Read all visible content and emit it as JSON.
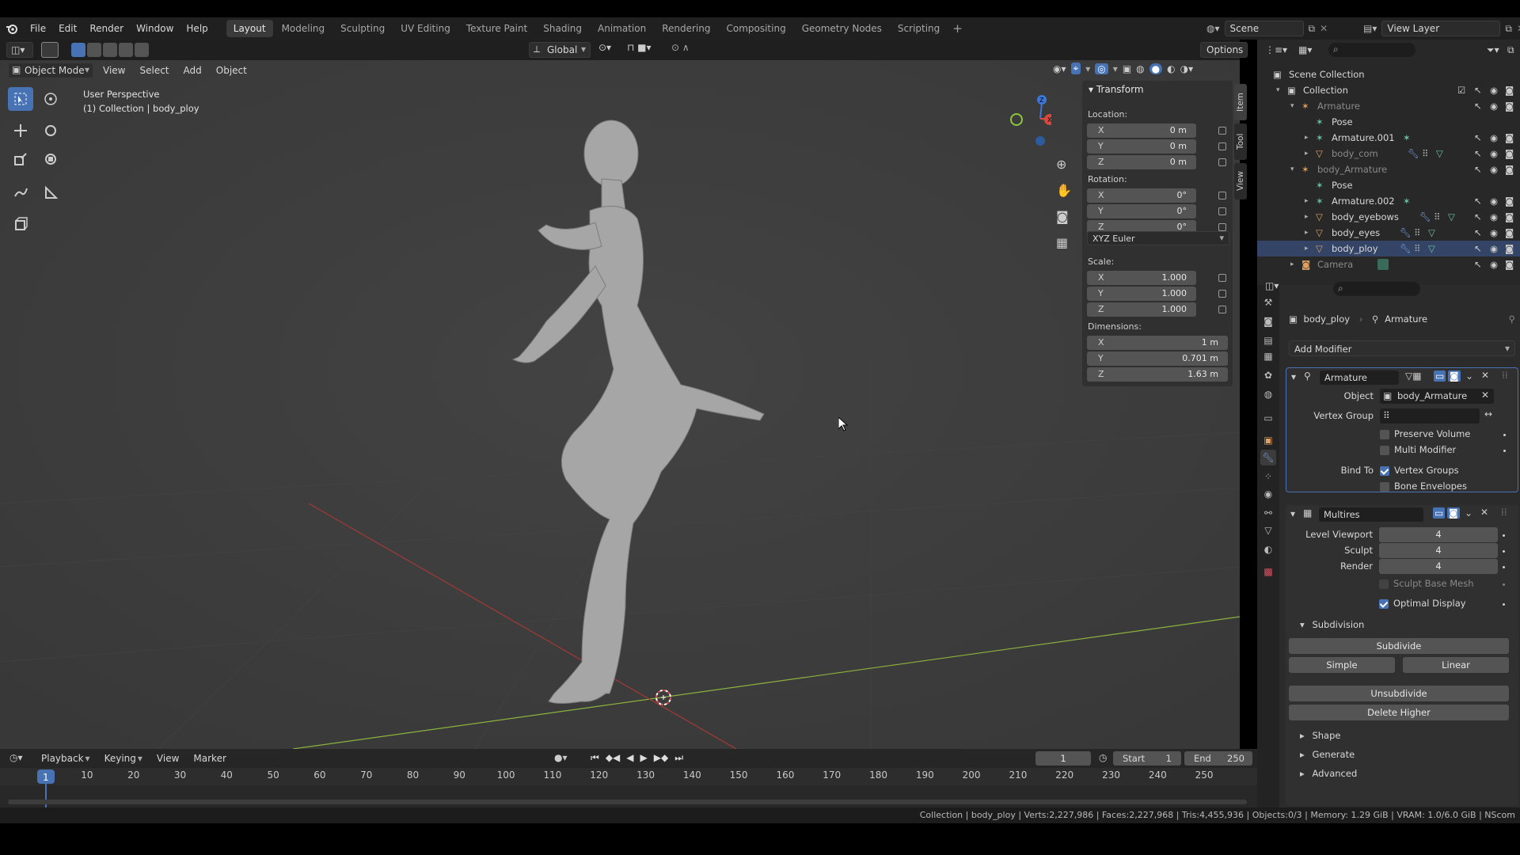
{
  "menu": [
    "File",
    "Edit",
    "Render",
    "Window",
    "Help"
  ],
  "workspaces": [
    {
      "label": "Layout",
      "active": true
    },
    {
      "label": "Modeling"
    },
    {
      "label": "Sculpting"
    },
    {
      "label": "UV Editing"
    },
    {
      "label": "Texture Paint"
    },
    {
      "label": "Shading"
    },
    {
      "label": "Animation"
    },
    {
      "label": "Rendering"
    },
    {
      "label": "Compositing"
    },
    {
      "label": "Geometry Nodes"
    },
    {
      "label": "Scripting"
    }
  ],
  "scene": "Scene",
  "view_layer": "View Layer",
  "viewport_header": {
    "mode": "Object Mode",
    "menus": [
      "View",
      "Select",
      "Add",
      "Object"
    ],
    "orientation": "Global",
    "options": "Options"
  },
  "viewport": {
    "perspective": "User Perspective",
    "collection_info": "(1) Collection | body_ploy"
  },
  "npanel": {
    "tabs": [
      "Item",
      "Tool",
      "View"
    ],
    "title": "Transform",
    "location_label": "Location:",
    "location": [
      {
        "axis": "X",
        "value": "0 m"
      },
      {
        "axis": "Y",
        "value": "0 m"
      },
      {
        "axis": "Z",
        "value": "0 m"
      }
    ],
    "rotation_label": "Rotation:",
    "rotation": [
      {
        "axis": "X",
        "value": "0°"
      },
      {
        "axis": "Y",
        "value": "0°"
      },
      {
        "axis": "Z",
        "value": "0°"
      }
    ],
    "rotation_mode": "XYZ Euler",
    "scale_label": "Scale:",
    "scale": [
      {
        "axis": "X",
        "value": "1.000"
      },
      {
        "axis": "Y",
        "value": "1.000"
      },
      {
        "axis": "Z",
        "value": "1.000"
      }
    ],
    "dimensions_label": "Dimensions:",
    "dimensions": [
      {
        "axis": "X",
        "value": "1 m"
      },
      {
        "axis": "Y",
        "value": "0.701 m"
      },
      {
        "axis": "Z",
        "value": "1.63 m"
      }
    ]
  },
  "outliner": {
    "rows": [
      {
        "label": "Scene Collection",
        "icon": "scene-collection-icon"
      },
      {
        "label": "Collection",
        "icon": "collection-icon"
      },
      {
        "label": "Armature",
        "icon": "armature-icon",
        "dim": true
      },
      {
        "label": "Pose",
        "icon": "pose-icon"
      },
      {
        "label": "Armature.001",
        "icon": "armature-data-icon"
      },
      {
        "label": "body_com",
        "icon": "mesh-object-icon",
        "dim": true
      },
      {
        "label": "body_Armature",
        "icon": "armature-icon",
        "dim": true
      },
      {
        "label": "Pose",
        "icon": "pose-icon"
      },
      {
        "label": "Armature.002",
        "icon": "armature-data-icon"
      },
      {
        "label": "body_eyebows",
        "icon": "mesh-object-icon"
      },
      {
        "label": "body_eyes",
        "icon": "mesh-object-icon"
      },
      {
        "label": "body_ploy",
        "icon": "mesh-object-icon"
      },
      {
        "label": "Camera",
        "icon": "camera-icon",
        "dim": true
      }
    ]
  },
  "properties": {
    "object": "body_ploy",
    "modifier_context": "Armature",
    "add_modifier": "Add Modifier",
    "armature_mod": {
      "name": "Armature",
      "object_label": "Object",
      "object_value": "body_Armature",
      "vertex_group_label": "Vertex Group",
      "preserve_volume": "Preserve Volume",
      "multi_modifier": "Multi Modifier",
      "bind_to_label": "Bind To",
      "vertex_groups": "Vertex Groups",
      "bone_envelopes": "Bone Envelopes"
    },
    "multires_mod": {
      "name": "Multires",
      "level_viewport_label": "Level Viewport",
      "level_viewport": "4",
      "sculpt_label": "Sculpt",
      "sculpt": "4",
      "render_label": "Render",
      "render": "4",
      "sculpt_base_mesh": "Sculpt Base Mesh",
      "optimal_display": "Optimal Display",
      "subdivision": "Subdivision",
      "subdivide": "Subdivide",
      "simple": "Simple",
      "linear": "Linear",
      "unsubdivide": "Unsubdivide",
      "delete_higher": "Delete Higher",
      "shape": "Shape",
      "generate": "Generate",
      "advanced": "Advanced"
    }
  },
  "timeline": {
    "menus": [
      "Playback",
      "Keying",
      "View",
      "Marker"
    ],
    "current_frame": "1",
    "start_label": "Start",
    "start": "1",
    "end_label": "End",
    "end": "250",
    "ticks": [
      "1",
      "10",
      "20",
      "30",
      "40",
      "50",
      "60",
      "70",
      "80",
      "90",
      "100",
      "110",
      "120",
      "130",
      "140",
      "150",
      "160",
      "170",
      "180",
      "190",
      "200",
      "210",
      "220",
      "230",
      "240",
      "250"
    ]
  },
  "status": "Collection | body_ploy | Verts:2,227,986 | Faces:2,227,968 | Tris:4,455,936 | Objects:0/3 | Memory: 1.29 GiB | VRAM: 1.0/6.0 GiB | NScom",
  "colors": {
    "accent": "#4772b3",
    "viewport_bg": "#3c3c3c",
    "panel_bg": "#303030",
    "x_axis": "#d9473f",
    "y_axis": "#8cc63f",
    "z_axis": "#3d78d8"
  }
}
